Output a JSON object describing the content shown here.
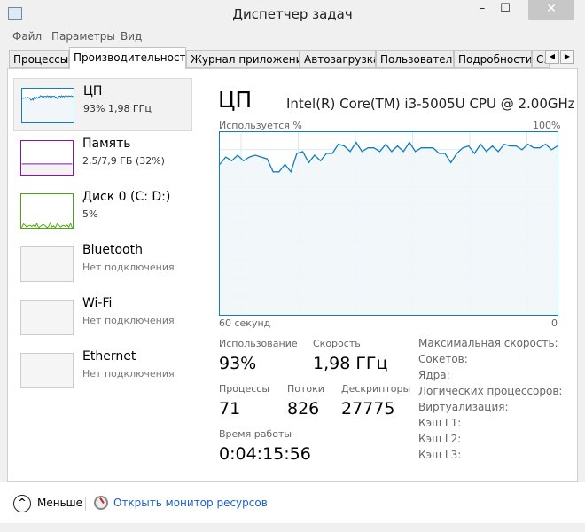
{
  "window": {
    "title": "Диспетчер задач",
    "minimize": "–",
    "maximize": "☐",
    "close": "✕"
  },
  "menu": [
    "Файл",
    "Параметры",
    "Вид"
  ],
  "tabs": [
    {
      "label": "Процессы"
    },
    {
      "label": "Производительность",
      "active": true
    },
    {
      "label": "Журнал приложений"
    },
    {
      "label": "Автозагрузка"
    },
    {
      "label": "Пользователи"
    },
    {
      "label": "Подробности"
    },
    {
      "label": "С..."
    }
  ],
  "tab_scroll": {
    "left": "◀",
    "right": "▶"
  },
  "sidebar": [
    {
      "name": "ЦП",
      "sub": "93%  1,98 ГГц",
      "color": "#117dbb",
      "selected": true
    },
    {
      "name": "Память",
      "sub": "2,5/7,9 ГБ (32%)",
      "color": "#8b12ae",
      "fill_percent": 32
    },
    {
      "name": "Диск 0 (C: D:)",
      "sub": "5%",
      "color": "#4da60c"
    },
    {
      "name": "Bluetooth",
      "sub": "Нет подключения"
    },
    {
      "name": "Wi-Fi",
      "sub": "Нет подключения"
    },
    {
      "name": "Ethernet",
      "sub": "Нет подключения"
    }
  ],
  "header": {
    "title": "ЦП",
    "model": "Intel(R) Core(TM) i3-5005U CPU @ 2.00GHz"
  },
  "chart_data": {
    "type": "line",
    "title": "Используется %",
    "ymax_label": "100%",
    "xlabel_left": "60 секунд",
    "xlabel_right": "0",
    "ylim": [
      0,
      100
    ],
    "grid": true,
    "color": "#117dbb",
    "values": [
      82,
      86,
      84,
      87,
      84,
      86,
      87,
      86,
      85,
      78,
      78,
      82,
      78,
      88,
      89,
      83,
      87,
      84,
      88,
      88,
      93,
      92,
      89,
      94,
      89,
      91,
      91,
      89,
      93,
      89,
      92,
      89,
      94,
      89,
      91,
      91,
      91,
      88,
      88,
      83,
      88,
      91,
      92,
      88,
      93,
      89,
      92,
      89,
      93,
      92,
      92,
      90,
      93,
      91,
      91,
      93,
      90,
      92
    ]
  },
  "stats": {
    "usage": {
      "label": "Использование",
      "value": "93%"
    },
    "speed": {
      "label": "Скорость",
      "value": "1,98 ГГц"
    },
    "processes": {
      "label": "Процессы",
      "value": "71"
    },
    "threads": {
      "label": "Потоки",
      "value": "826"
    },
    "handles": {
      "label": "Дескрипторы",
      "value": "27775"
    },
    "uptime": {
      "label": "Время работы",
      "value": "0:04:15:56"
    }
  },
  "specs": [
    "Максимальная скорость:",
    "Сокетов:",
    "Ядра:",
    "Логических процессоров:",
    "Виртуализация:",
    "Кэш L1:",
    "Кэш L2:",
    "Кэш L3:"
  ],
  "footer": {
    "less": "Меньше",
    "resource_monitor": "Открыть монитор ресурсов"
  }
}
